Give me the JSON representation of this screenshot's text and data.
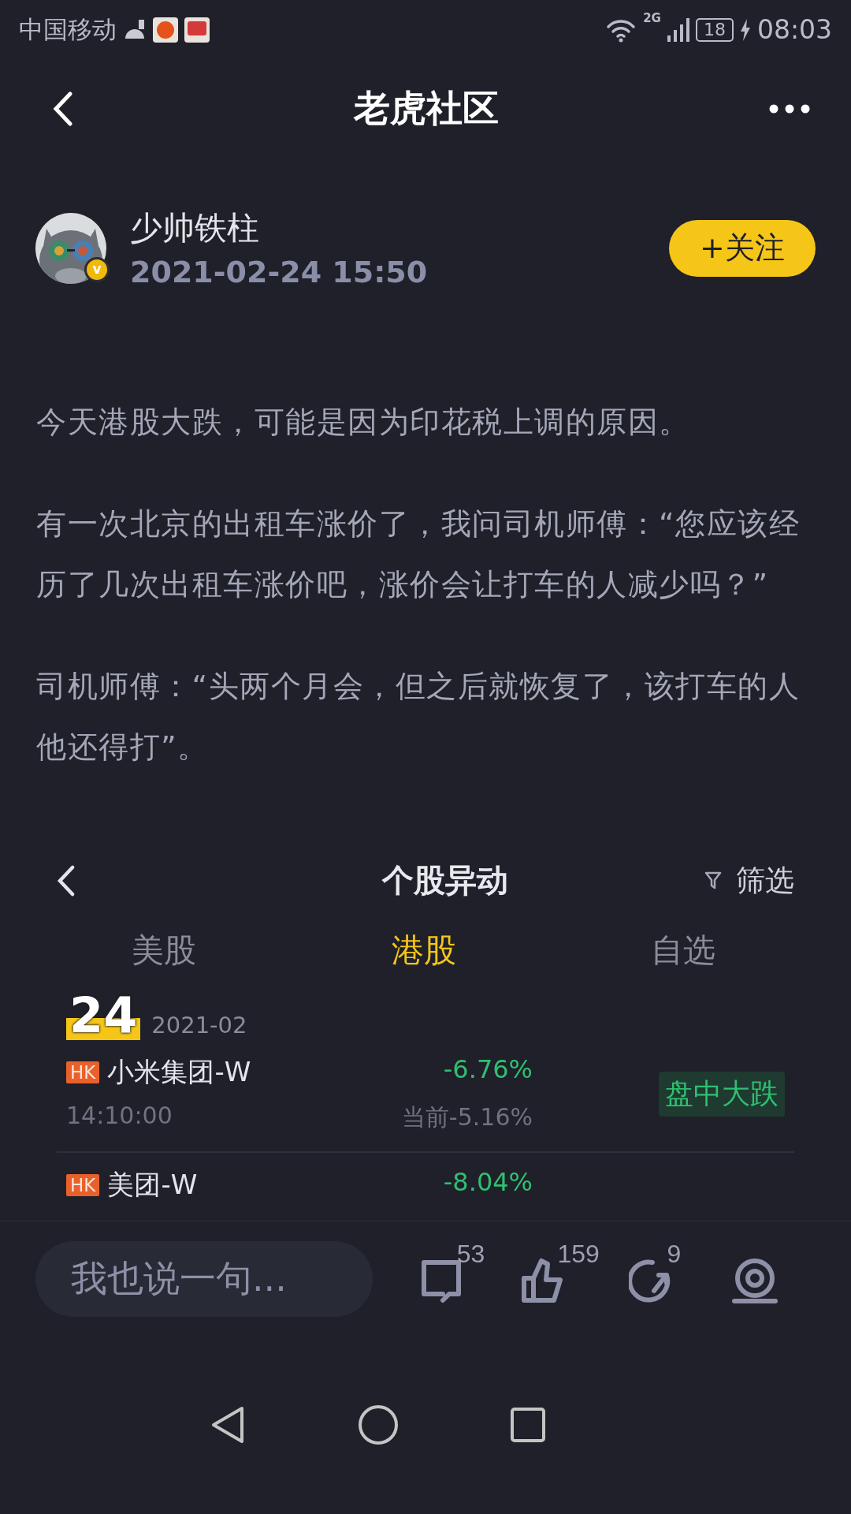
{
  "status_bar": {
    "carrier": "中国移动",
    "network": "2G",
    "battery": "18",
    "time": "08:03"
  },
  "header": {
    "title": "老虎社区"
  },
  "author": {
    "name": "少帅铁柱",
    "date": "2021-02-24 15:50",
    "verified_badge": "v",
    "follow_button": "+关注"
  },
  "paragraphs": [
    "今天港股大跌，可能是因为印花税上调的原因。",
    "有一次北京的出租车涨价了，我问司机师傅：“您应该经历了几次出租车涨价吧，涨价会让打车的人减少吗？”",
    "司机师傅：“头两个月会，但之后就恢复了，该打车的人他还得打”。"
  ],
  "embedded": {
    "title": "个股异动",
    "filter": "筛选",
    "tabs": [
      {
        "label": "美股",
        "selected": false
      },
      {
        "label": "港股",
        "selected": true
      },
      {
        "label": "自选",
        "selected": false
      }
    ],
    "date_day": "24",
    "date_month": "2021-02",
    "stocks": [
      {
        "market": "HK",
        "name": "小米集团-W",
        "change": "-6.76%",
        "time": "14:10:00",
        "current": "当前-5.16%",
        "tag": "盘中大跌"
      },
      {
        "market": "HK",
        "name": "美团-W",
        "change": "-8.04%"
      }
    ]
  },
  "bottom_bar": {
    "comment_placeholder": "我也说一句...",
    "actions": [
      {
        "kind": "comment",
        "count": "53"
      },
      {
        "kind": "like",
        "count": "159"
      },
      {
        "kind": "share",
        "count": "9"
      },
      {
        "kind": "reward"
      }
    ]
  }
}
